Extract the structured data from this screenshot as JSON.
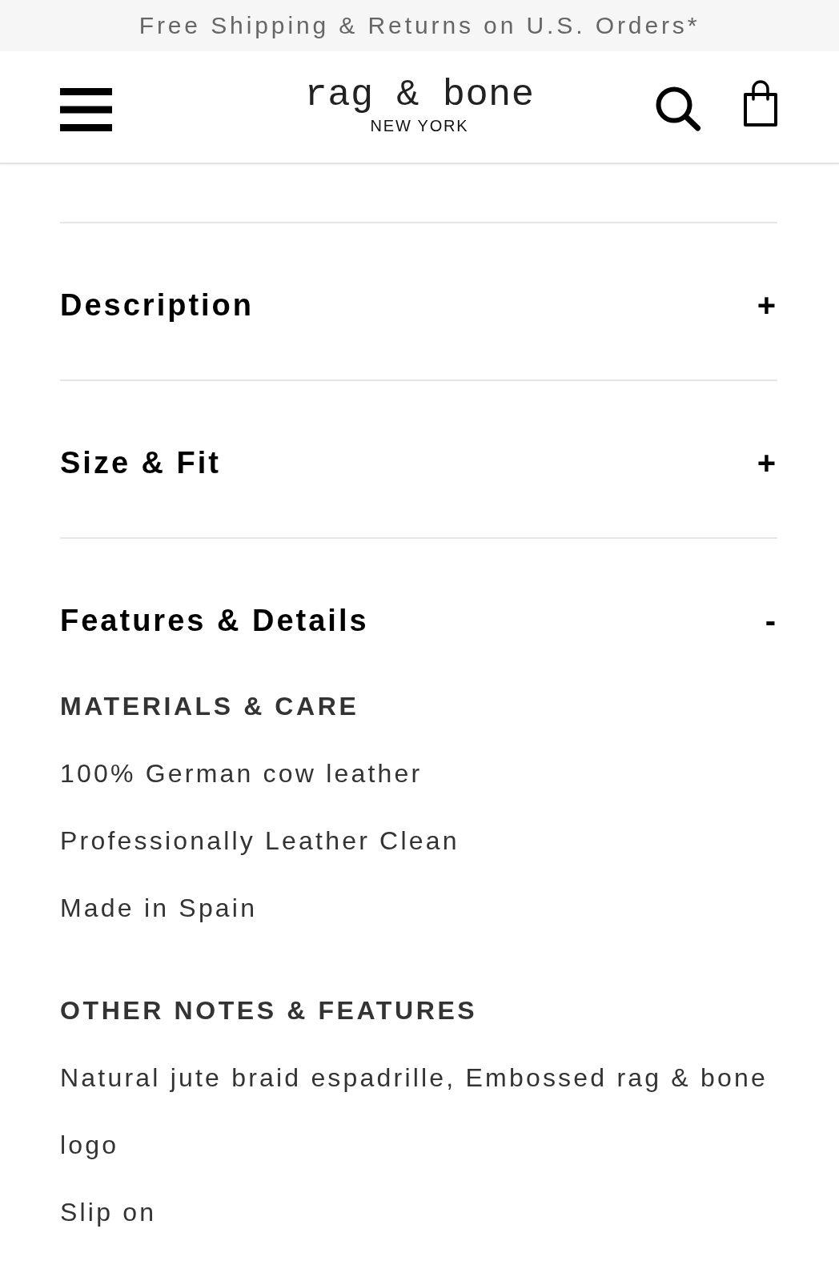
{
  "promo_banner": {
    "text": "Free Shipping & Returns on U.S. Orders*"
  },
  "header": {
    "logo": {
      "wordmark": "rag & bone",
      "tagline": "NEW YORK"
    }
  },
  "accordion": [
    {
      "title": "Description",
      "toggle": "+",
      "expanded": false
    },
    {
      "title": "Size & Fit",
      "toggle": "+",
      "expanded": false
    },
    {
      "title": "Features & Details",
      "toggle": "-",
      "expanded": true,
      "sections": [
        {
          "heading": "MATERIALS & CARE",
          "lines": [
            "100% German cow leather",
            "Professionally Leather Clean",
            "Made in Spain"
          ]
        },
        {
          "heading": "OTHER NOTES & FEATURES",
          "lines": [
            "Natural jute braid espadrille, Embossed rag & bone logo",
            "Slip on"
          ]
        }
      ]
    }
  ]
}
